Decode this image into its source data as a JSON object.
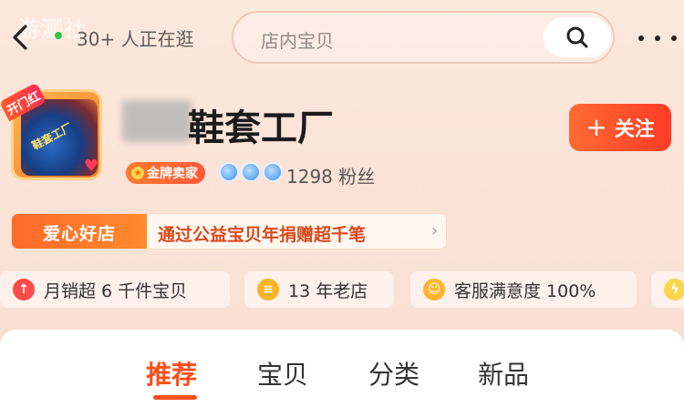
{
  "header": {
    "watermark": "游测社",
    "online_text": "30+ 人正在逛",
    "search_placeholder": "店内宝贝"
  },
  "shop": {
    "logo_badge": "开门红",
    "logo_text": "鞋套工厂",
    "name": "鞋套工厂",
    "gold_badge": "金牌卖家",
    "fans": "1298 粉丝",
    "follow_label": "关注"
  },
  "charity": {
    "tag": "爱心好店",
    "text": "通过公益宝贝年捐赠超千笔"
  },
  "stats": [
    {
      "label": "月销超 6 千件宝贝",
      "icon": "arrow-up-icon",
      "color": "#ff4b4b"
    },
    {
      "label": "13 年老店",
      "icon": "shop-icon",
      "color": "#ffb32a"
    },
    {
      "label": "客服满意度 100%",
      "icon": "smile-icon",
      "color": "#ffb32a"
    }
  ],
  "tabs": [
    {
      "label": "推荐",
      "active": true
    },
    {
      "label": "宝贝",
      "active": false
    },
    {
      "label": "分类",
      "active": false
    },
    {
      "label": "新品",
      "active": false
    }
  ],
  "colors": {
    "accent": "#ff4e1a",
    "online": "#2cc84d"
  }
}
